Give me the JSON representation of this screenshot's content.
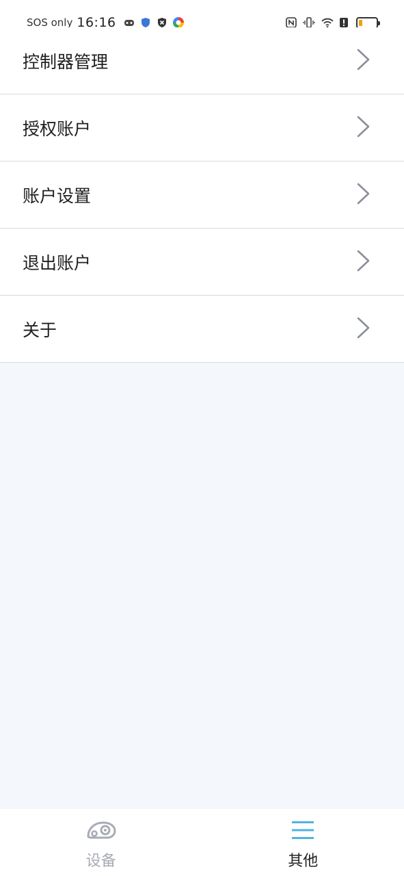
{
  "status_bar": {
    "carrier": "SOS only",
    "time": "16:16",
    "icons_left": [
      "game-icon",
      "shield-icon",
      "shield-x-icon",
      "colorful-app-icon"
    ],
    "icons_right": [
      "nfc-icon",
      "vibrate-icon",
      "wifi-icon",
      "alert-icon",
      "battery-icon"
    ],
    "battery_level": 0.2,
    "battery_color": "#f2a20b"
  },
  "menu": {
    "items": [
      {
        "label": "控制器管理"
      },
      {
        "label": "授权账户"
      },
      {
        "label": "账户设置"
      },
      {
        "label": "退出账户"
      },
      {
        "label": "关于"
      }
    ]
  },
  "tabbar": {
    "tabs": [
      {
        "label": "设备",
        "icon": "device-icon",
        "active": false
      },
      {
        "label": "其他",
        "icon": "menu-icon",
        "active": true
      }
    ],
    "active_color": "#4fb3df",
    "inactive_color": "#a7abb3"
  }
}
